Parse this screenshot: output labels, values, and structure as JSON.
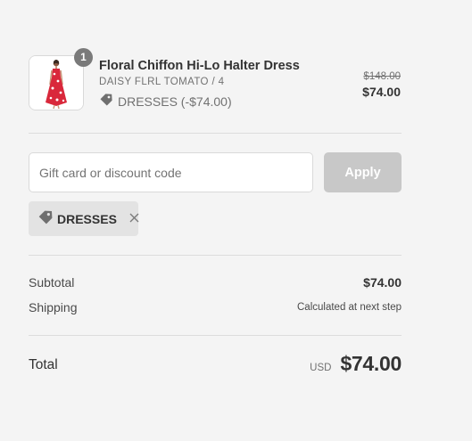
{
  "line_item": {
    "quantity": "1",
    "name": "Floral Chiffon Hi-Lo Halter Dress",
    "variant": "DAISY FLRL TOMATO / 4",
    "discount_label": "DRESSES (-$74.00)",
    "original_price": "$148.00",
    "price": "$74.00",
    "thumbnail_icon": "red-floral-dress-image"
  },
  "discount_form": {
    "placeholder": "Gift card or discount code",
    "value": "",
    "apply_label": "Apply"
  },
  "applied_code": {
    "label": "DRESSES",
    "remove_icon": "close-icon"
  },
  "totals": {
    "subtotal_label": "Subtotal",
    "subtotal_value": "$74.00",
    "shipping_label": "Shipping",
    "shipping_value": "Calculated at next step",
    "total_label": "Total",
    "currency": "USD",
    "total_value": "$74.00"
  },
  "colors": {
    "background": "#f4f4f4",
    "apply_button_disabled": "#c8c8c8",
    "chip_background": "#e3e3e3",
    "badge": "#7a7a7a",
    "dress_red": "#d9283b"
  }
}
